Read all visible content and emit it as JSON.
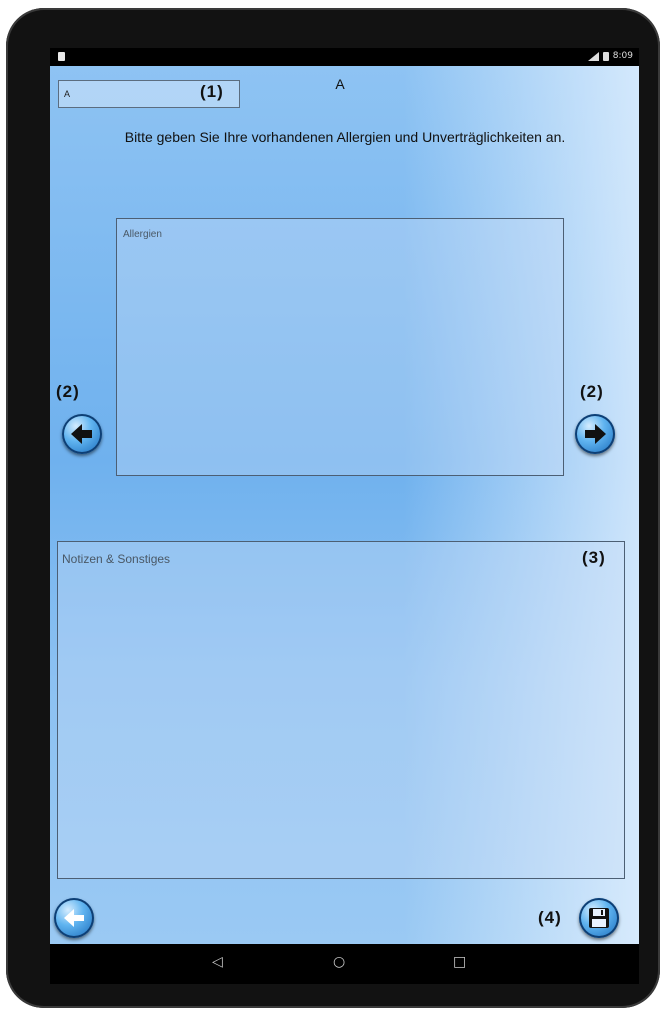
{
  "status_bar": {
    "time": "8:09"
  },
  "header": {
    "field_value": "A",
    "title": "A",
    "prompt": "Bitte geben Sie Ihre vorhandenen Allergien und Unverträglichkeiten an."
  },
  "callouts": {
    "c1": "(1)",
    "c2_left": "(2)",
    "c2_right": "(2)",
    "c3": "(3)",
    "c4": "(4)"
  },
  "allergy_box": {
    "label": "Allergien"
  },
  "notes_box": {
    "label": "Notizen & Sonstiges"
  },
  "icons": {
    "prev": "arrow-left-icon",
    "next": "arrow-right-icon",
    "back": "back-arrow-icon",
    "save": "floppy-disk-icon"
  },
  "nav_bar": {
    "back": "◁",
    "home": "○",
    "recents": "□"
  },
  "colors": {
    "accent": "#1e78d0",
    "background": "#8ec3f3"
  }
}
